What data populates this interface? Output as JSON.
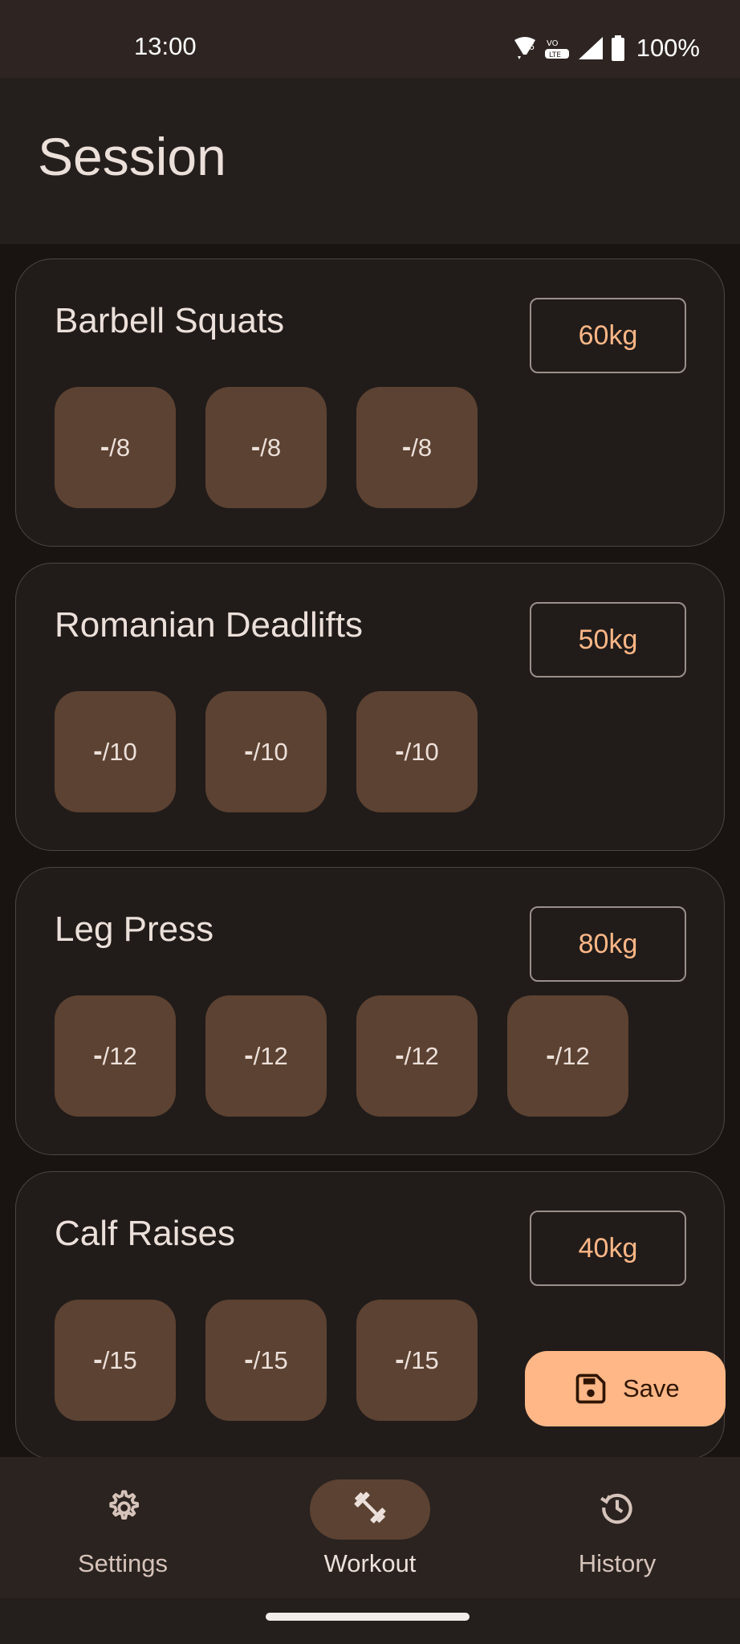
{
  "status_bar": {
    "time": "13:00",
    "battery": "100%",
    "icons": [
      "wifi-icon",
      "volte-icon",
      "signal-icon",
      "battery-icon"
    ]
  },
  "header": {
    "title": "Session"
  },
  "exercises": [
    {
      "name": "Barbell Squats",
      "weight": "60kg",
      "sets": [
        {
          "reps_done": "-",
          "reps_target": "/8"
        },
        {
          "reps_done": "-",
          "reps_target": "/8"
        },
        {
          "reps_done": "-",
          "reps_target": "/8"
        }
      ]
    },
    {
      "name": "Romanian Deadlifts",
      "weight": "50kg",
      "sets": [
        {
          "reps_done": "-",
          "reps_target": "/10"
        },
        {
          "reps_done": "-",
          "reps_target": "/10"
        },
        {
          "reps_done": "-",
          "reps_target": "/10"
        }
      ]
    },
    {
      "name": "Leg Press",
      "weight": "80kg",
      "sets": [
        {
          "reps_done": "-",
          "reps_target": "/12"
        },
        {
          "reps_done": "-",
          "reps_target": "/12"
        },
        {
          "reps_done": "-",
          "reps_target": "/12"
        },
        {
          "reps_done": "-",
          "reps_target": "/12"
        }
      ]
    },
    {
      "name": "Calf Raises",
      "weight": "40kg",
      "sets": [
        {
          "reps_done": "-",
          "reps_target": "/15"
        },
        {
          "reps_done": "-",
          "reps_target": "/15"
        },
        {
          "reps_done": "-",
          "reps_target": "/15"
        }
      ]
    }
  ],
  "fab": {
    "label": "Save",
    "icon": "save-icon"
  },
  "bottom_nav": {
    "active": "workout",
    "items": [
      {
        "id": "settings",
        "label": "Settings",
        "icon": "gear-icon"
      },
      {
        "id": "workout",
        "label": "Workout",
        "icon": "dumbbell-icon"
      },
      {
        "id": "history",
        "label": "History",
        "icon": "history-icon"
      }
    ]
  },
  "colors": {
    "accent": "#ffb787",
    "set_button": "#5c4232",
    "card_bg": "#211c1a",
    "background": "#191412"
  }
}
